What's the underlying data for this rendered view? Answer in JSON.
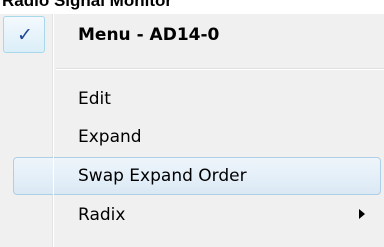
{
  "top_strip": {
    "text": "Radio Signal Monitor"
  },
  "menu": {
    "header": {
      "label": "Menu - AD14-0",
      "checked": true,
      "check_glyph": "✓"
    },
    "items": [
      {
        "label": "Edit"
      },
      {
        "label": "Expand"
      },
      {
        "label": "Swap Expand Order",
        "hovered": true
      },
      {
        "label": "Radix",
        "has_submenu": true,
        "submenu_icon": "chevron-right-icon"
      }
    ]
  },
  "colors": {
    "menu_background": "#f0f0f0",
    "highlight_border": "#aecfe6",
    "check_color": "#20459a"
  }
}
